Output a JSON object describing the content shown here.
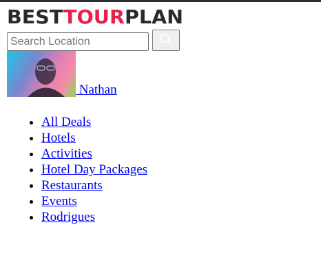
{
  "brand": {
    "word1": "BEST",
    "word2": "TOUR",
    "word3": "PLAN"
  },
  "search": {
    "placeholder": "Search Location",
    "value": "",
    "icon": "search-icon"
  },
  "user": {
    "name": "Nathan"
  },
  "nav": {
    "items": [
      {
        "label": "All Deals"
      },
      {
        "label": "Hotels"
      },
      {
        "label": "Activities"
      },
      {
        "label": "Hotel Day Packages"
      },
      {
        "label": "Restaurants"
      },
      {
        "label": "Events"
      },
      {
        "label": "Rodrigues"
      }
    ]
  },
  "colors": {
    "brand_dark": "#2a2a2a",
    "brand_accent": "#e8214b",
    "link": "#0000ee"
  }
}
